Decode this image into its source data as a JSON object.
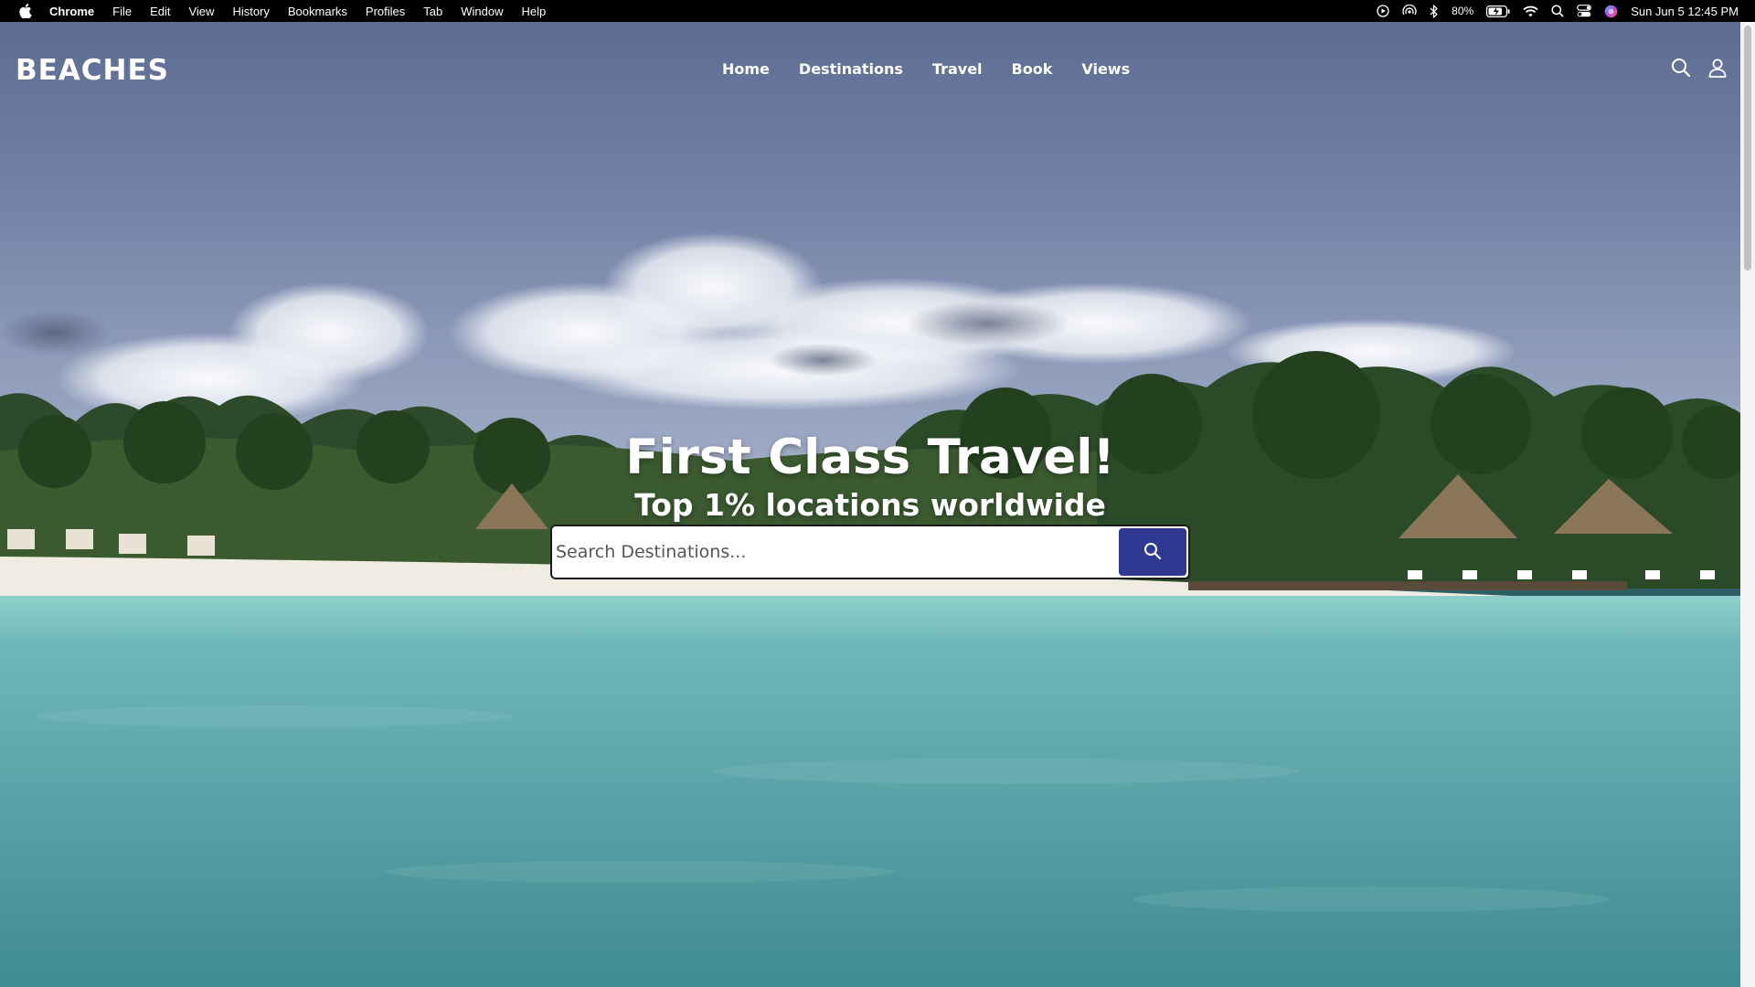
{
  "menubar": {
    "app_name": "Chrome",
    "items": [
      "File",
      "Edit",
      "View",
      "History",
      "Bookmarks",
      "Profiles",
      "Tab",
      "Window",
      "Help"
    ],
    "battery_percent": "80%",
    "clock": "Sun Jun 5  12:45 PM"
  },
  "site": {
    "logo": "BEACHES",
    "nav": [
      "Home",
      "Destinations",
      "Travel",
      "Book",
      "Views"
    ]
  },
  "hero": {
    "title": "First Class Travel!",
    "subtitle": "Top 1% locations worldwide"
  },
  "search": {
    "placeholder": "Search Destinations...",
    "value": ""
  },
  "colors": {
    "search_button": "#2f3994",
    "sky": "#6f7ea3",
    "water": "#5fa7ab"
  }
}
